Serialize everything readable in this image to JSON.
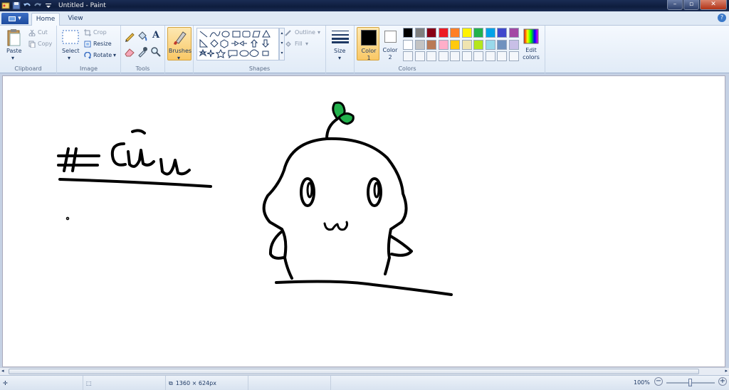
{
  "window": {
    "title": "Untitled - Paint",
    "close_symbol": "✕",
    "minimize_symbol": "–",
    "maximize_symbol": "▫"
  },
  "tabs": [
    {
      "label": "Home"
    },
    {
      "label": "View"
    }
  ],
  "help_symbol": "?",
  "clipboard": {
    "paste": "Paste",
    "cut": "Cut",
    "copy": "Copy",
    "group": "Clipboard"
  },
  "image": {
    "select": "Select",
    "crop": "Crop",
    "resize": "Resize",
    "rotate": "Rotate",
    "group": "Image"
  },
  "tools": {
    "group": "Tools",
    "text_tool": "A"
  },
  "brushes": {
    "label": "Brushes"
  },
  "shapes": {
    "group": "Shapes",
    "outline": "Outline",
    "fill": "Fill"
  },
  "size": {
    "label": "Size"
  },
  "colors": {
    "group": "Colors",
    "color1_label": "Color",
    "color1_num": "1",
    "color2_label": "Color",
    "color2_num": "2",
    "edit_colors": "Edit colors",
    "color1": "#000000",
    "color2": "#ffffff",
    "palette_row1": [
      "#000000",
      "#7f7f7f",
      "#880015",
      "#ed1c24",
      "#ff7f27",
      "#fff200",
      "#22b14c",
      "#00a2e8",
      "#3f48cc",
      "#a349a4"
    ],
    "palette_row2": [
      "#ffffff",
      "#c3c3c3",
      "#b97a57",
      "#ffaec9",
      "#ffc90e",
      "#efe4b0",
      "#b5e61d",
      "#99d9ea",
      "#7092be",
      "#c8bfe7"
    ]
  },
  "drawing": {
    "text": "# Cứu",
    "stroke_color": "#000000",
    "leaf_color": "#22b14c"
  },
  "status": {
    "image_size": "1360 × 624px",
    "zoom": "100%",
    "zoom_level_percent": 100
  }
}
